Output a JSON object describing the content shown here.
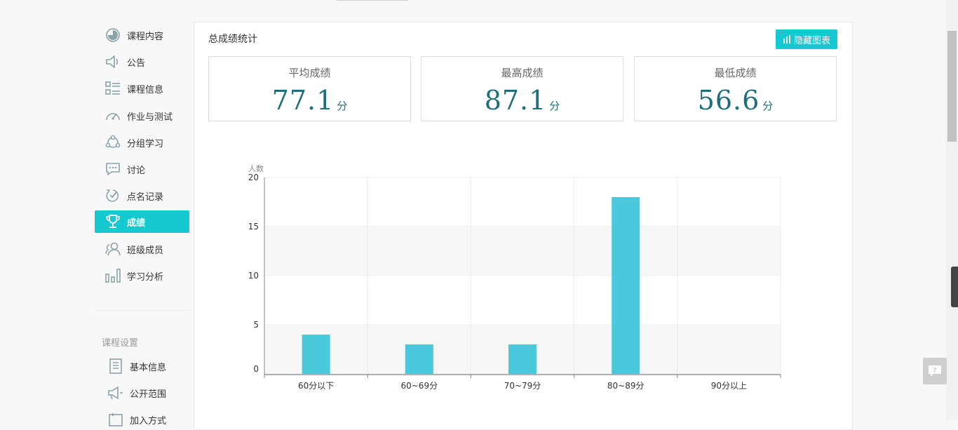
{
  "sidebar": {
    "items": [
      {
        "label": "课程内容",
        "icon": "course-content-icon"
      },
      {
        "label": "公告",
        "icon": "announcement-icon"
      },
      {
        "label": "课程信息",
        "icon": "course-info-icon"
      },
      {
        "label": "作业与测试",
        "icon": "gauge-icon"
      },
      {
        "label": "分组学习",
        "icon": "group-icon"
      },
      {
        "label": "讨论",
        "icon": "chat-icon"
      },
      {
        "label": "点名记录",
        "icon": "roll-call-icon"
      },
      {
        "label": "成绩",
        "icon": "trophy-icon",
        "active": true
      },
      {
        "label": "班级成员",
        "icon": "members-icon"
      },
      {
        "label": "学习分析",
        "icon": "analysis-icon"
      }
    ],
    "settings_title": "课程设置",
    "settings": [
      {
        "label": "基本信息",
        "icon": "document-icon"
      },
      {
        "label": "公开范围",
        "icon": "megaphone-icon"
      },
      {
        "label": "加入方式",
        "icon": "join-icon"
      }
    ]
  },
  "panel": {
    "title": "总成绩统计",
    "hide_chart_label": "隐藏图表",
    "stats": [
      {
        "label": "平均成绩",
        "value": "77.1",
        "unit": "分"
      },
      {
        "label": "最高成绩",
        "value": "87.1",
        "unit": "分"
      },
      {
        "label": "最低成绩",
        "value": "56.6",
        "unit": "分"
      }
    ]
  },
  "colors": {
    "accent": "#16c8cf",
    "bar": "#4bc8dc",
    "value_text": "#1f6f78"
  },
  "chart_data": {
    "type": "bar",
    "ylabel": "人数",
    "categories": [
      "60分以下",
      "60~69分",
      "70~79分",
      "80~89分",
      "90分以上"
    ],
    "values": [
      4,
      3,
      3,
      18,
      0
    ],
    "yticks": [
      0,
      5,
      10,
      15,
      20
    ],
    "ylim": [
      0,
      20
    ],
    "grid": true
  }
}
